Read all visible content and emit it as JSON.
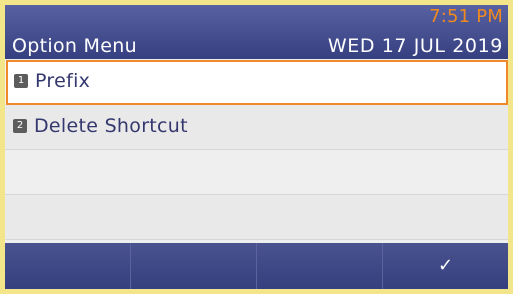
{
  "header": {
    "title": "Option Menu",
    "time": "7:51 PM",
    "date": "WED 17 JUL 2019"
  },
  "menu": {
    "items": [
      {
        "num": "1",
        "label": "Prefix"
      },
      {
        "num": "2",
        "label": "Delete Shortcut"
      },
      {
        "num": "",
        "label": ""
      },
      {
        "num": "",
        "label": ""
      }
    ],
    "selected_index": 0
  },
  "softkeys": [
    {
      "label": ""
    },
    {
      "label": ""
    },
    {
      "label": ""
    },
    {
      "label": "✓"
    }
  ],
  "colors": {
    "bezel": "#f3e68a",
    "header": "#363f7f",
    "time_accent": "#f08a1e",
    "selection_border": "#ef8a2a"
  }
}
